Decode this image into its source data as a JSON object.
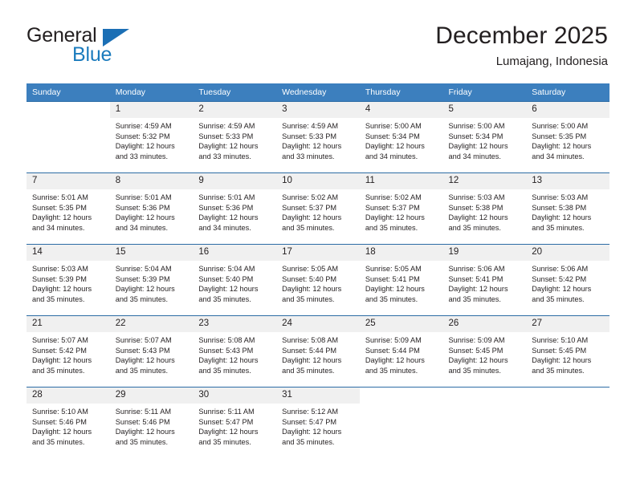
{
  "logo": {
    "word_one": "General",
    "word_two": "Blue",
    "triangle_color": "#1b6fb5",
    "blue_color": "#1b7bbd"
  },
  "header": {
    "title": "December 2025",
    "subtitle": "Lumajang, Indonesia"
  },
  "theme": {
    "header_bg": "#3c7fbe",
    "cell_header_bg": "#f0f0f0",
    "rule_color": "#2c6ca5",
    "text_color": "#231f20"
  },
  "weekdays": [
    "Sunday",
    "Monday",
    "Tuesday",
    "Wednesday",
    "Thursday",
    "Friday",
    "Saturday"
  ],
  "labels": {
    "sunrise": "Sunrise:",
    "sunset": "Sunset:",
    "daylight": "Daylight:"
  },
  "weeks": [
    [
      {
        "day": "",
        "blank": true
      },
      {
        "day": "1",
        "sunrise": "Sunrise: 4:59 AM",
        "sunset": "Sunset: 5:32 PM",
        "daylight_a": "Daylight: 12 hours",
        "daylight_b": "and 33 minutes."
      },
      {
        "day": "2",
        "sunrise": "Sunrise: 4:59 AM",
        "sunset": "Sunset: 5:33 PM",
        "daylight_a": "Daylight: 12 hours",
        "daylight_b": "and 33 minutes."
      },
      {
        "day": "3",
        "sunrise": "Sunrise: 4:59 AM",
        "sunset": "Sunset: 5:33 PM",
        "daylight_a": "Daylight: 12 hours",
        "daylight_b": "and 33 minutes."
      },
      {
        "day": "4",
        "sunrise": "Sunrise: 5:00 AM",
        "sunset": "Sunset: 5:34 PM",
        "daylight_a": "Daylight: 12 hours",
        "daylight_b": "and 34 minutes."
      },
      {
        "day": "5",
        "sunrise": "Sunrise: 5:00 AM",
        "sunset": "Sunset: 5:34 PM",
        "daylight_a": "Daylight: 12 hours",
        "daylight_b": "and 34 minutes."
      },
      {
        "day": "6",
        "sunrise": "Sunrise: 5:00 AM",
        "sunset": "Sunset: 5:35 PM",
        "daylight_a": "Daylight: 12 hours",
        "daylight_b": "and 34 minutes."
      }
    ],
    [
      {
        "day": "7",
        "sunrise": "Sunrise: 5:01 AM",
        "sunset": "Sunset: 5:35 PM",
        "daylight_a": "Daylight: 12 hours",
        "daylight_b": "and 34 minutes."
      },
      {
        "day": "8",
        "sunrise": "Sunrise: 5:01 AM",
        "sunset": "Sunset: 5:36 PM",
        "daylight_a": "Daylight: 12 hours",
        "daylight_b": "and 34 minutes."
      },
      {
        "day": "9",
        "sunrise": "Sunrise: 5:01 AM",
        "sunset": "Sunset: 5:36 PM",
        "daylight_a": "Daylight: 12 hours",
        "daylight_b": "and 34 minutes."
      },
      {
        "day": "10",
        "sunrise": "Sunrise: 5:02 AM",
        "sunset": "Sunset: 5:37 PM",
        "daylight_a": "Daylight: 12 hours",
        "daylight_b": "and 35 minutes."
      },
      {
        "day": "11",
        "sunrise": "Sunrise: 5:02 AM",
        "sunset": "Sunset: 5:37 PM",
        "daylight_a": "Daylight: 12 hours",
        "daylight_b": "and 35 minutes."
      },
      {
        "day": "12",
        "sunrise": "Sunrise: 5:03 AM",
        "sunset": "Sunset: 5:38 PM",
        "daylight_a": "Daylight: 12 hours",
        "daylight_b": "and 35 minutes."
      },
      {
        "day": "13",
        "sunrise": "Sunrise: 5:03 AM",
        "sunset": "Sunset: 5:38 PM",
        "daylight_a": "Daylight: 12 hours",
        "daylight_b": "and 35 minutes."
      }
    ],
    [
      {
        "day": "14",
        "sunrise": "Sunrise: 5:03 AM",
        "sunset": "Sunset: 5:39 PM",
        "daylight_a": "Daylight: 12 hours",
        "daylight_b": "and 35 minutes."
      },
      {
        "day": "15",
        "sunrise": "Sunrise: 5:04 AM",
        "sunset": "Sunset: 5:39 PM",
        "daylight_a": "Daylight: 12 hours",
        "daylight_b": "and 35 minutes."
      },
      {
        "day": "16",
        "sunrise": "Sunrise: 5:04 AM",
        "sunset": "Sunset: 5:40 PM",
        "daylight_a": "Daylight: 12 hours",
        "daylight_b": "and 35 minutes."
      },
      {
        "day": "17",
        "sunrise": "Sunrise: 5:05 AM",
        "sunset": "Sunset: 5:40 PM",
        "daylight_a": "Daylight: 12 hours",
        "daylight_b": "and 35 minutes."
      },
      {
        "day": "18",
        "sunrise": "Sunrise: 5:05 AM",
        "sunset": "Sunset: 5:41 PM",
        "daylight_a": "Daylight: 12 hours",
        "daylight_b": "and 35 minutes."
      },
      {
        "day": "19",
        "sunrise": "Sunrise: 5:06 AM",
        "sunset": "Sunset: 5:41 PM",
        "daylight_a": "Daylight: 12 hours",
        "daylight_b": "and 35 minutes."
      },
      {
        "day": "20",
        "sunrise": "Sunrise: 5:06 AM",
        "sunset": "Sunset: 5:42 PM",
        "daylight_a": "Daylight: 12 hours",
        "daylight_b": "and 35 minutes."
      }
    ],
    [
      {
        "day": "21",
        "sunrise": "Sunrise: 5:07 AM",
        "sunset": "Sunset: 5:42 PM",
        "daylight_a": "Daylight: 12 hours",
        "daylight_b": "and 35 minutes."
      },
      {
        "day": "22",
        "sunrise": "Sunrise: 5:07 AM",
        "sunset": "Sunset: 5:43 PM",
        "daylight_a": "Daylight: 12 hours",
        "daylight_b": "and 35 minutes."
      },
      {
        "day": "23",
        "sunrise": "Sunrise: 5:08 AM",
        "sunset": "Sunset: 5:43 PM",
        "daylight_a": "Daylight: 12 hours",
        "daylight_b": "and 35 minutes."
      },
      {
        "day": "24",
        "sunrise": "Sunrise: 5:08 AM",
        "sunset": "Sunset: 5:44 PM",
        "daylight_a": "Daylight: 12 hours",
        "daylight_b": "and 35 minutes."
      },
      {
        "day": "25",
        "sunrise": "Sunrise: 5:09 AM",
        "sunset": "Sunset: 5:44 PM",
        "daylight_a": "Daylight: 12 hours",
        "daylight_b": "and 35 minutes."
      },
      {
        "day": "26",
        "sunrise": "Sunrise: 5:09 AM",
        "sunset": "Sunset: 5:45 PM",
        "daylight_a": "Daylight: 12 hours",
        "daylight_b": "and 35 minutes."
      },
      {
        "day": "27",
        "sunrise": "Sunrise: 5:10 AM",
        "sunset": "Sunset: 5:45 PM",
        "daylight_a": "Daylight: 12 hours",
        "daylight_b": "and 35 minutes."
      }
    ],
    [
      {
        "day": "28",
        "sunrise": "Sunrise: 5:10 AM",
        "sunset": "Sunset: 5:46 PM",
        "daylight_a": "Daylight: 12 hours",
        "daylight_b": "and 35 minutes."
      },
      {
        "day": "29",
        "sunrise": "Sunrise: 5:11 AM",
        "sunset": "Sunset: 5:46 PM",
        "daylight_a": "Daylight: 12 hours",
        "daylight_b": "and 35 minutes."
      },
      {
        "day": "30",
        "sunrise": "Sunrise: 5:11 AM",
        "sunset": "Sunset: 5:47 PM",
        "daylight_a": "Daylight: 12 hours",
        "daylight_b": "and 35 minutes."
      },
      {
        "day": "31",
        "sunrise": "Sunrise: 5:12 AM",
        "sunset": "Sunset: 5:47 PM",
        "daylight_a": "Daylight: 12 hours",
        "daylight_b": "and 35 minutes."
      },
      {
        "day": "",
        "blank": true
      },
      {
        "day": "",
        "blank": true
      },
      {
        "day": "",
        "blank": true
      }
    ]
  ]
}
